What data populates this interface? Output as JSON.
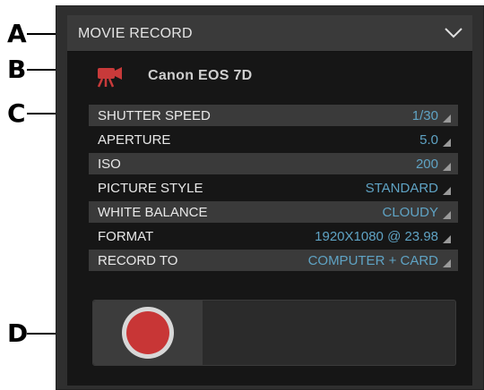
{
  "callouts": {
    "a": "A",
    "b": "B",
    "c": "C",
    "d": "D"
  },
  "panel": {
    "title": "MOVIE RECORD",
    "collapse_icon": "chevron-down-icon"
  },
  "camera": {
    "icon": "movie-camera-icon",
    "name": "Canon EOS 7D"
  },
  "settings": [
    {
      "label": "SHUTTER SPEED",
      "value": "1/30"
    },
    {
      "label": "APERTURE",
      "value": "5.0"
    },
    {
      "label": "ISO",
      "value": "200"
    },
    {
      "label": "PICTURE STYLE",
      "value": "STANDARD"
    },
    {
      "label": "WHITE BALANCE",
      "value": "CLOUDY"
    },
    {
      "label": "FORMAT",
      "value": "1920X1080 @ 23.98"
    },
    {
      "label": "RECORD TO",
      "value": "COMPUTER + CARD"
    }
  ],
  "record": {
    "icon": "record-icon"
  },
  "colors": {
    "accent_value": "#5fa3c4",
    "record_red": "#c83636",
    "camera_icon": "#c83a3a"
  }
}
